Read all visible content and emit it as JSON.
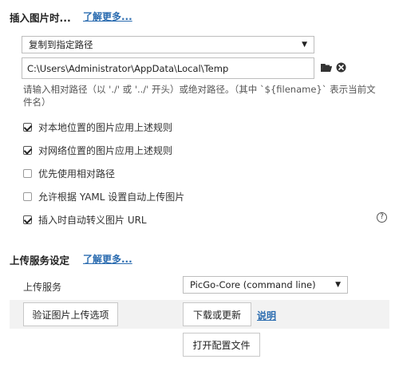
{
  "image_section": {
    "title": "插入图片时...",
    "learn_more": "了解更多...",
    "action_select": {
      "value": "复制到指定路径"
    },
    "path_input": {
      "value": "C:\\Users\\Administrator\\AppData\\Local\\Temp"
    },
    "path_hint": "请输入相对路径（以 './' 或 '../' 开头）或绝对路径。（其中 `${filename}` 表示当前文件名）",
    "options": [
      {
        "label": "对本地位置的图片应用上述规则",
        "checked": true
      },
      {
        "label": "对网络位置的图片应用上述规则",
        "checked": true
      },
      {
        "label": "优先使用相对路径",
        "checked": false
      },
      {
        "label": "允许根据 YAML 设置自动上传图片",
        "checked": false
      },
      {
        "label": "插入时自动转义图片 URL",
        "checked": true
      }
    ],
    "help_icon": "?"
  },
  "upload_section": {
    "title": "上传服务设定",
    "learn_more": "了解更多...",
    "service_label": "上传服务",
    "service_select": {
      "value": "PicGo-Core (command line)"
    },
    "verify_button": "验证图片上传选项",
    "download_button": "下载或更新",
    "docs_link": "说明",
    "open_config_button": "打开配置文件"
  }
}
